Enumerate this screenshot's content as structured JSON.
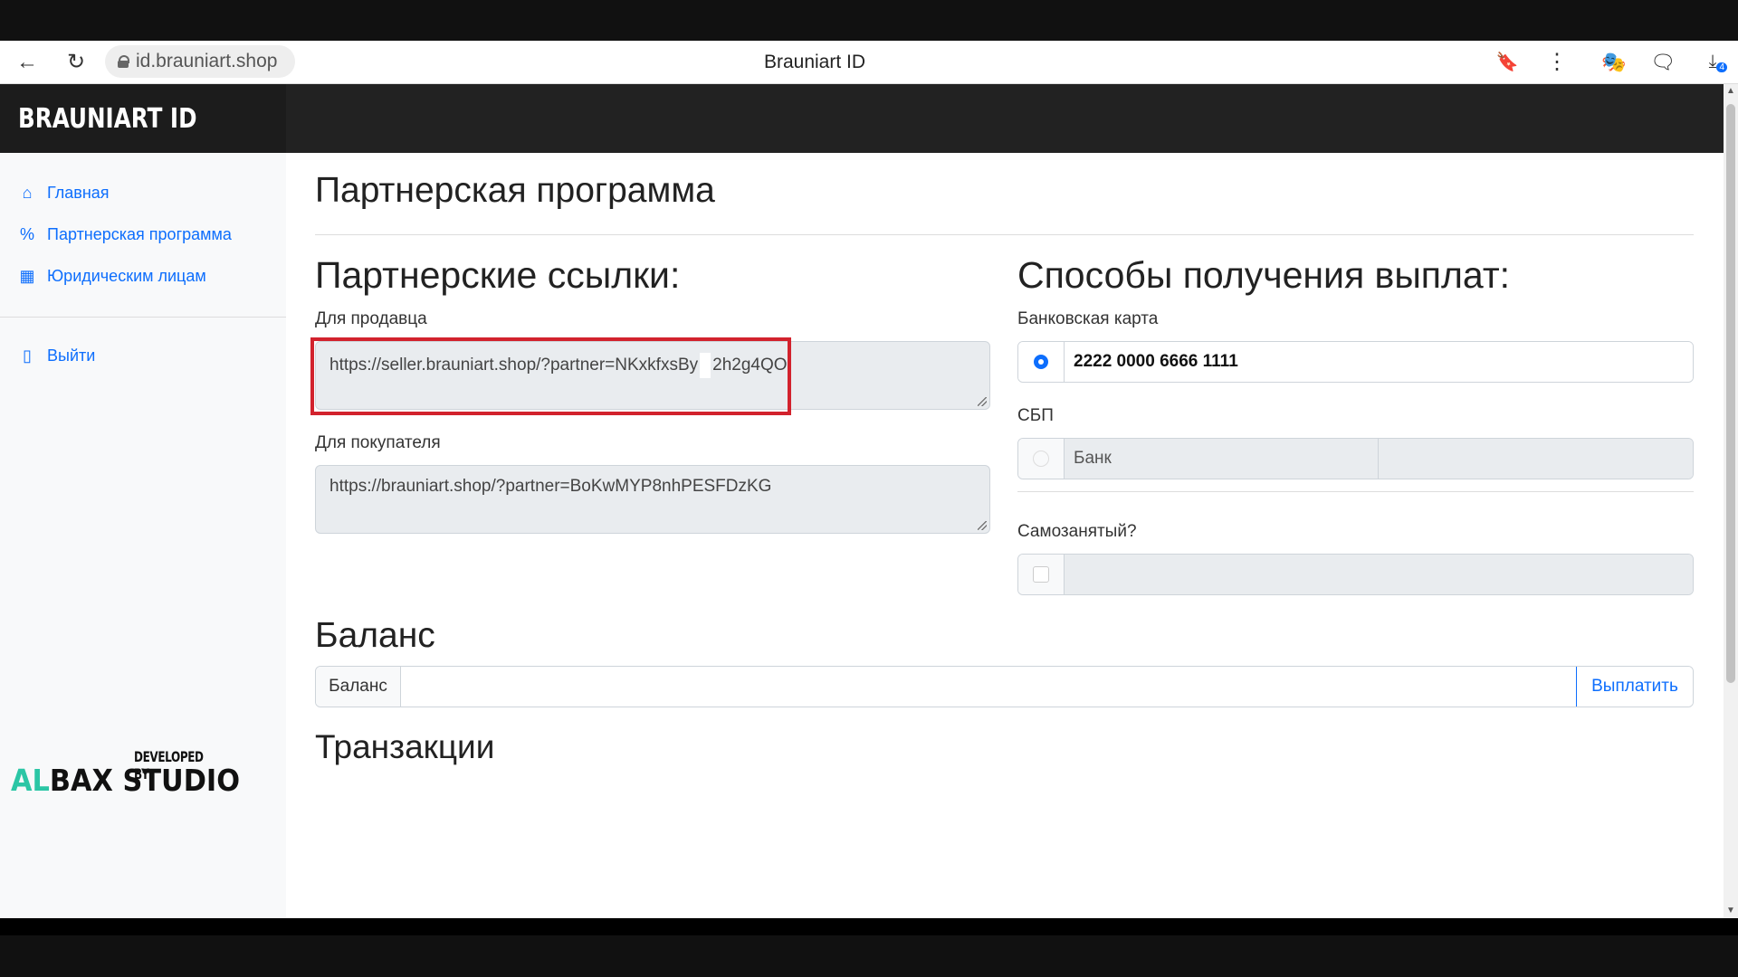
{
  "browser": {
    "url": "id.brauniart.shop",
    "tab_title": "Brauniart ID",
    "download_badge": "4"
  },
  "header": {
    "brand": "BRAUNIART ID"
  },
  "sidebar": {
    "items": [
      {
        "label": "Главная",
        "icon": "home-icon"
      },
      {
        "label": "Партнерская программа",
        "icon": "percent-icon"
      },
      {
        "label": "Юридическим лицам",
        "icon": "building-icon"
      }
    ],
    "logout_label": "Выйти",
    "developer": {
      "top": "DEVELOPED BY",
      "name_accent": "AL",
      "name_rest": "BAX STUDIO"
    }
  },
  "main": {
    "page_title": "Партнерская программа",
    "links": {
      "heading": "Партнерские ссылки:",
      "seller_label": "Для продавца",
      "seller_url_part1": "https://seller.brauniart.shop/?partner=NKxkfxsBy",
      "seller_url_part2": "2h2g4QO",
      "buyer_label": "Для покупателя",
      "buyer_url": "https://brauniart.shop/?partner=BoKwMYP8nhPESFDzKG"
    },
    "payouts": {
      "heading": "Способы получения выплат:",
      "card_label": "Банковская карта",
      "card_number": "2222 0000 6666 1111",
      "sbp_label": "СБП",
      "bank_placeholder": "Банк",
      "self_employed_label": "Самозанятый?"
    },
    "balance": {
      "heading": "Баланс",
      "label": "Баланс",
      "pay_button": "Выплатить"
    },
    "transactions_heading": "Транзакции"
  },
  "colors": {
    "accent": "#0d6efd",
    "highlight": "#d2222d",
    "brand_green": "#2bc6a5"
  }
}
